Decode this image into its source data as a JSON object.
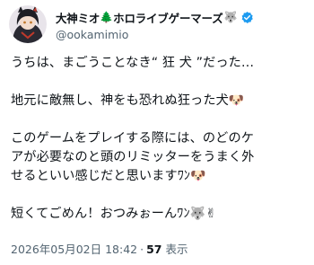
{
  "header": {
    "display_name": "大神ミオ",
    "display_suffix": "ホロライブゲーマーズ",
    "handle": "@ookamimio"
  },
  "icons": {
    "tree": "🌲",
    "wolf": "🐺",
    "dog": "🐶",
    "peace": "✌"
  },
  "tweet": {
    "line1": "うちは、まごうことなき“ 狂 犬 ”だった…",
    "line2": "地元に敵無し、神をも恐れぬ狂った犬",
    "line3": "このゲームをプレイする際には、のどのケ",
    "line4": "アが必要なのと頭のリミッターをうまく外",
    "line5": "せるといい感じだと思いますﾜﾝ",
    "line6": "短くてごめん！おつみぉーんﾜﾝ"
  },
  "meta": {
    "timestamp": "2026年05月02日 18:42",
    "dot": "·",
    "views_count": "57",
    "views_label": "表示"
  },
  "colors": {
    "text": "#0f1419",
    "secondary": "#536471",
    "verified": "#1d9bf0"
  }
}
